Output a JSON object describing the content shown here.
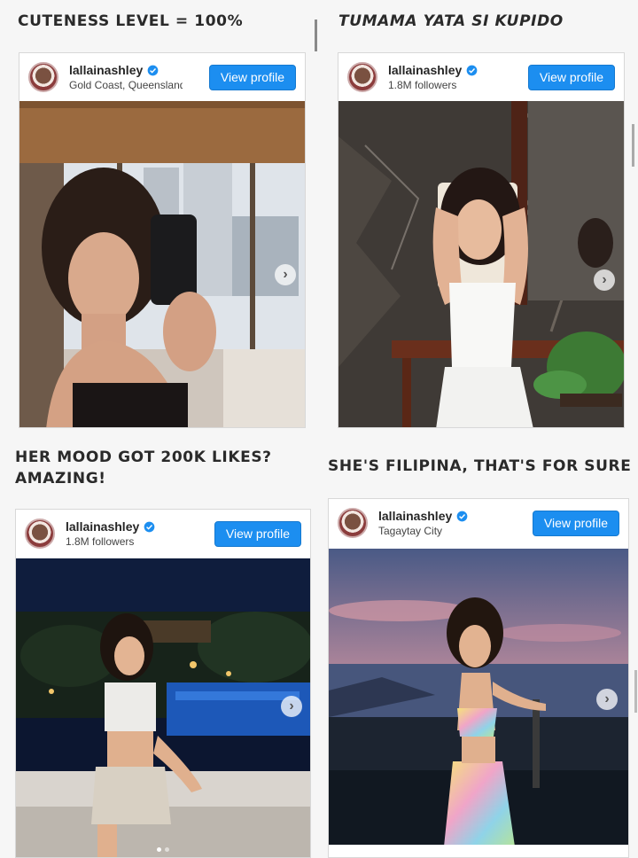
{
  "captions": {
    "top_left": "CUTENESS LEVEL = 100%",
    "top_right": "TUMAMA YATA SI KUPIDO",
    "bottom_left_line1": "HER MOOD GOT 200K LIKES?",
    "bottom_left_line2": "AMAZING!",
    "bottom_right": "SHE'S FILIPINA, THAT'S FOR SURE"
  },
  "cards": [
    {
      "username": "lallainashley",
      "subtitle": "Gold Coast, Queensland",
      "button": "View profile",
      "photo": "mirror-selfie"
    },
    {
      "username": "lallainashley",
      "subtitle": "1.8M followers",
      "button": "View profile",
      "photo": "white-dress-marble"
    },
    {
      "username": "lallainashley",
      "subtitle": "1.8M followers",
      "button": "View profile",
      "photo": "night-pool"
    },
    {
      "username": "lallainashley",
      "subtitle": "Tagaytay City",
      "button": "View profile",
      "photo": "sunset-lake"
    }
  ],
  "colors": {
    "button_blue": "#1c8ef0",
    "verified_blue": "#1c8ef0",
    "caption_text": "#2a2a2a",
    "background": "#f6f6f6"
  },
  "icons": {
    "verified": "verified-badge-icon",
    "next": "chevron-right-icon",
    "avatar": "avatar"
  }
}
